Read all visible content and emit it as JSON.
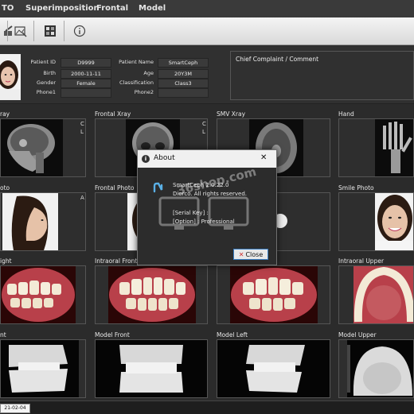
{
  "menu": [
    "TO",
    "Superimposition",
    "Frontal",
    "Model"
  ],
  "toolbar": {
    "icons": [
      "toolbar-tool-icon",
      "image-edit-icon",
      "grid-image-icon",
      "info-icon"
    ]
  },
  "patient": {
    "fields_left": [
      {
        "label": "Patient ID",
        "value": "D9999"
      },
      {
        "label": "Birth",
        "value": "2000-11-11"
      },
      {
        "label": "Gender",
        "value": "Female"
      },
      {
        "label": "Phone1",
        "value": ""
      }
    ],
    "fields_right": [
      {
        "label": "Patient Name",
        "value": "SmartCeph"
      },
      {
        "label": "Age",
        "value": "20Y3M"
      },
      {
        "label": "Classification",
        "value": "Class3"
      },
      {
        "label": "Phone2",
        "value": ""
      }
    ],
    "complaint_title": "Chief Complaint / Comment"
  },
  "tiles": [
    {
      "label": "ray"
    },
    {
      "label": "Frontal Xray"
    },
    {
      "label": "SMV Xray"
    },
    {
      "label": "Hand"
    },
    {
      "label": "oto"
    },
    {
      "label": "Frontal Photo"
    },
    {
      "label": ""
    },
    {
      "label": "Smile Photo"
    },
    {
      "label": "ight"
    },
    {
      "label": "Intraoral Front"
    },
    {
      "label": ""
    },
    {
      "label": "Intraoral Upper"
    },
    {
      "label": "nt"
    },
    {
      "label": "Model Front"
    },
    {
      "label": "Model Left"
    },
    {
      "label": "Model Upper"
    }
  ],
  "tile_marks": {
    "lateral_1": "C",
    "lateral_2": "L",
    "frontal_1": "C",
    "frontal_2": "L",
    "photo_a": "A"
  },
  "status": {
    "date": "21-02-04"
  },
  "about": {
    "title": "About",
    "close_glyph": "✕",
    "product": "SmartCeph 2.0.22.0",
    "company": "Diorco.  All rights reserved.",
    "serial": "[Serial Key] :",
    "option": "[Option] : Professional",
    "close_label": "Close",
    "watermark": "36shop.com"
  },
  "colors": {
    "accent": "#3c7fc4",
    "dialog_bg": "#2c2c2c",
    "app_bg": "#2b2b2b"
  }
}
